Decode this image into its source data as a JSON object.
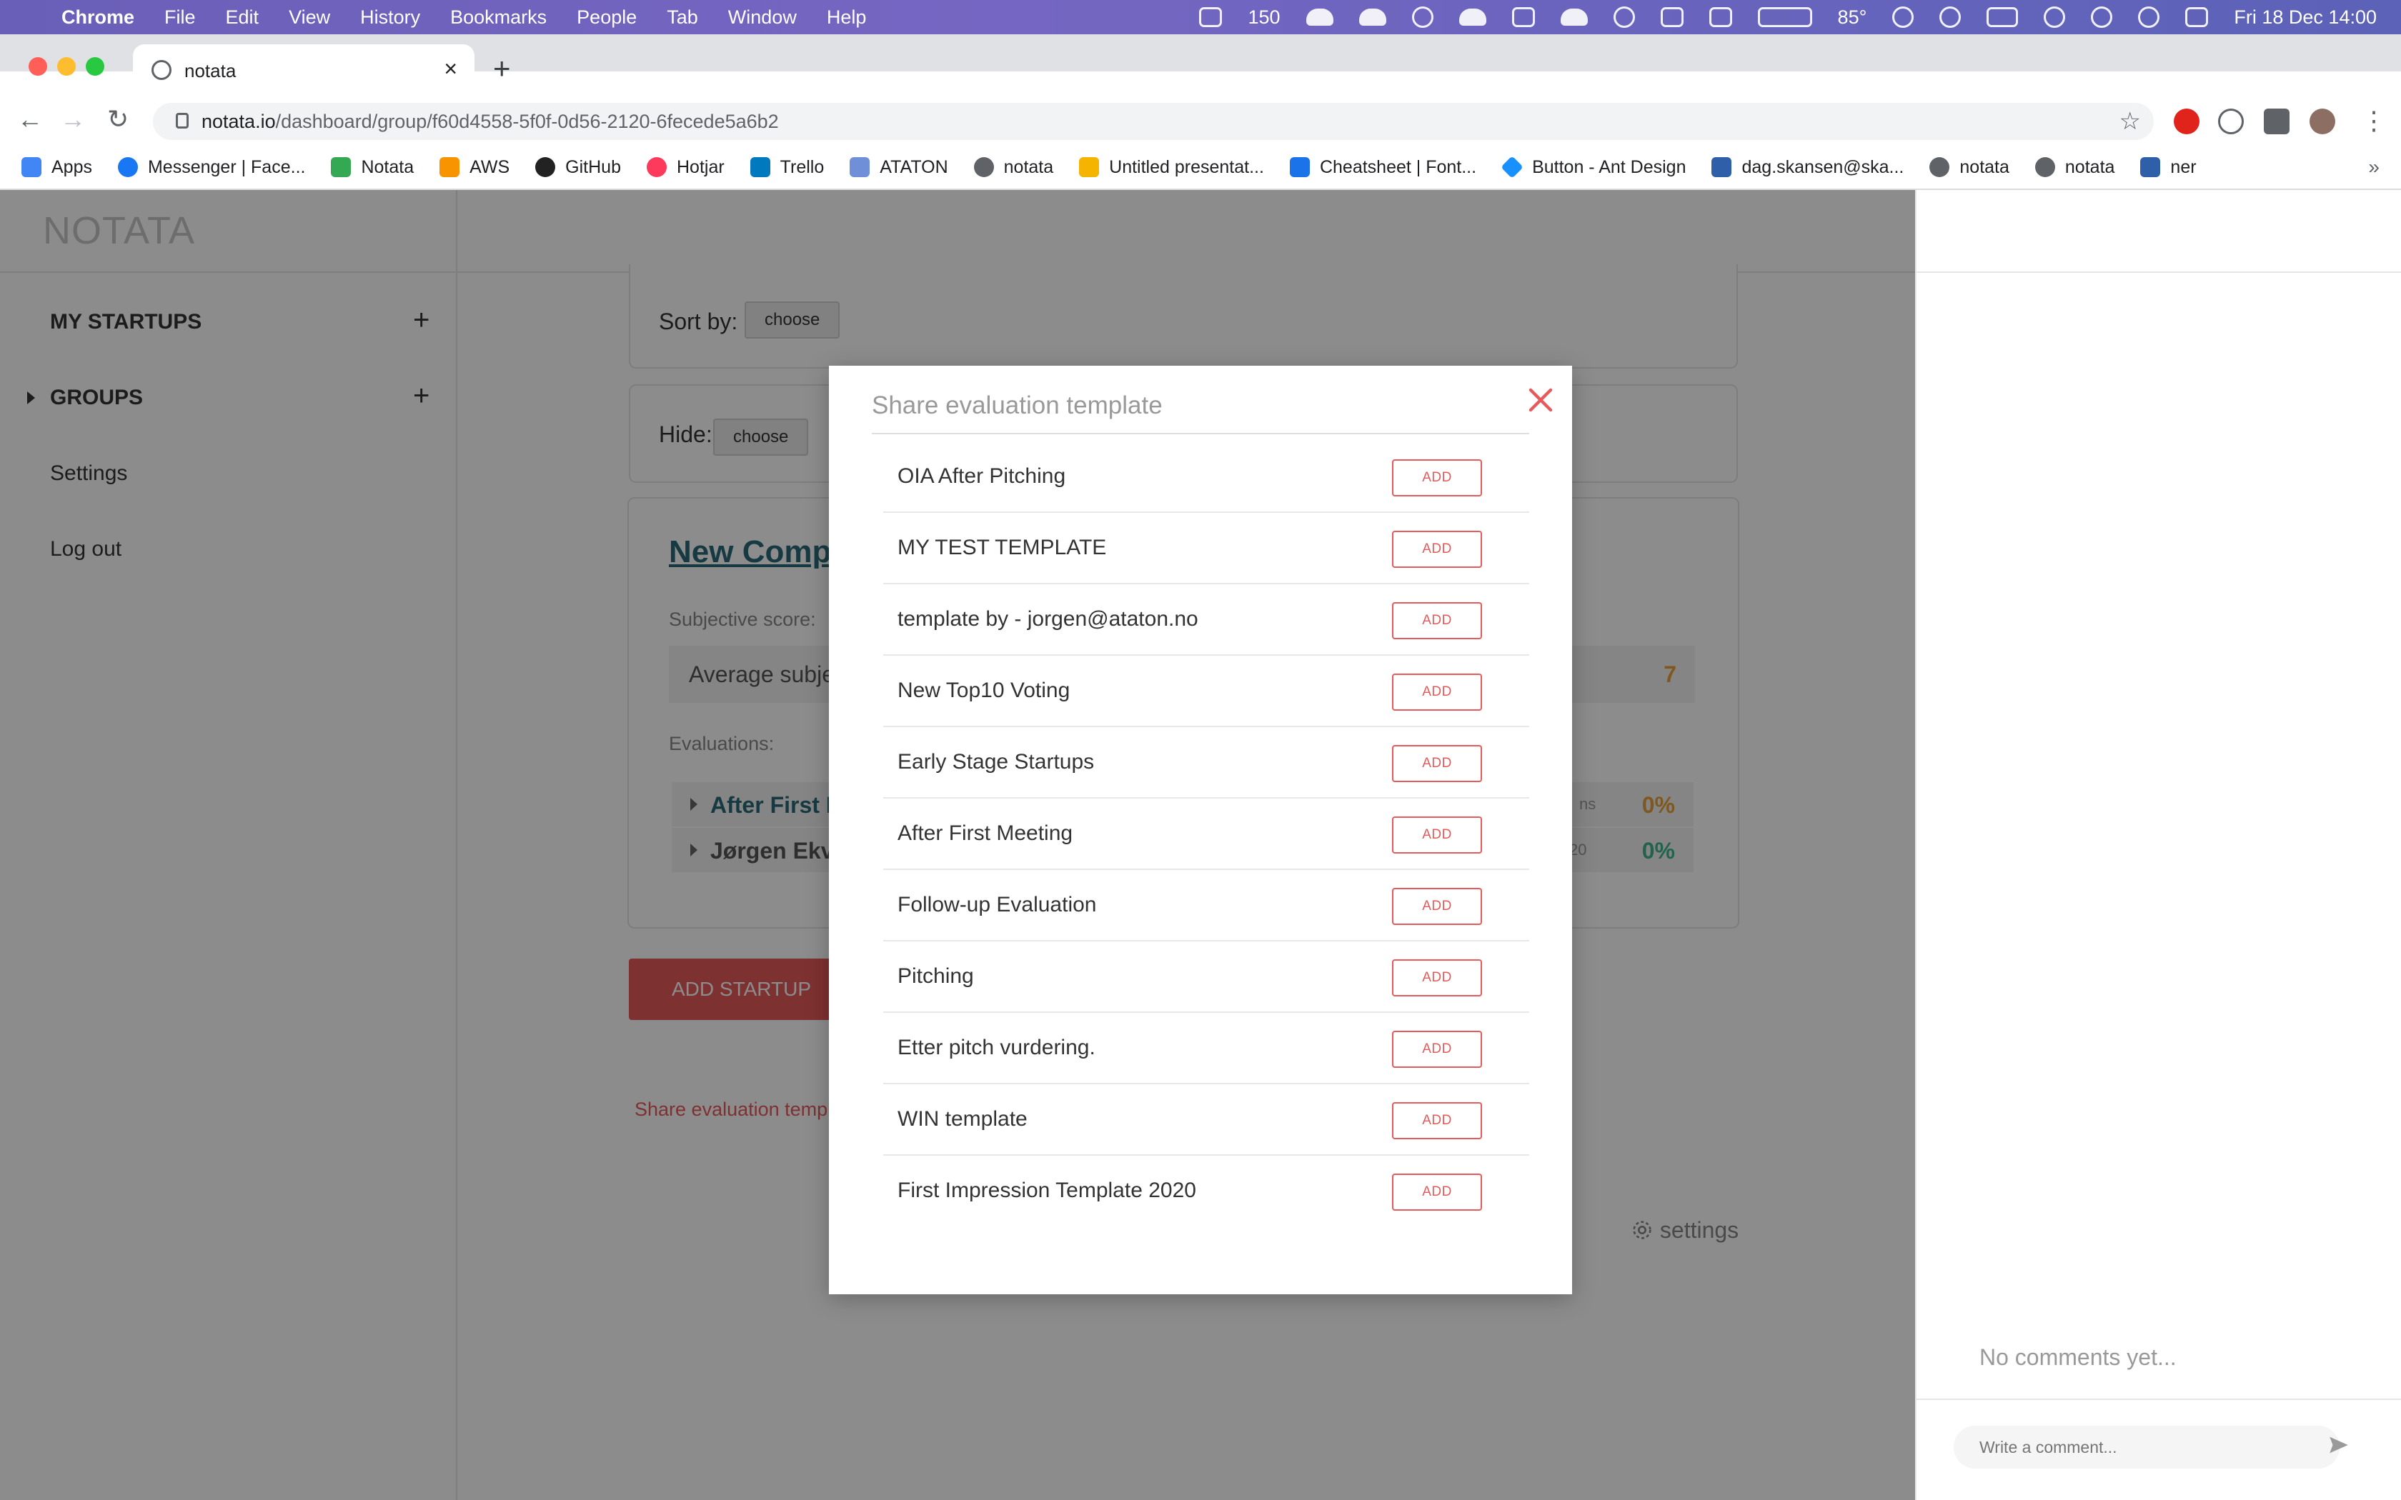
{
  "menubar": {
    "app": "Chrome",
    "items": [
      "File",
      "Edit",
      "View",
      "History",
      "Bookmarks",
      "People",
      "Tab",
      "Window",
      "Help"
    ],
    "status_count": "150",
    "temperature": "85°",
    "datetime": "Fri 18 Dec  14:00"
  },
  "browser": {
    "tab_title": "notata",
    "url_host": "notata.io",
    "url_path": "/dashboard/group/f60d4558-5f0f-0d56-2120-6fecede5a6b2",
    "bookmarks": [
      {
        "label": "Apps",
        "color": "#4285f4"
      },
      {
        "label": "Messenger | Face...",
        "color": "#1877f2"
      },
      {
        "label": "Notata",
        "color": "#34a853"
      },
      {
        "label": "AWS",
        "color": "#f79400"
      },
      {
        "label": "GitHub",
        "color": "#222222"
      },
      {
        "label": "Hotjar",
        "color": "#fd3a5c"
      },
      {
        "label": "Trello",
        "color": "#0079bf"
      },
      {
        "label": "ATATON",
        "color": "#6f8fd8"
      },
      {
        "label": "notata",
        "color": "#5f6368"
      },
      {
        "label": "Untitled presentat...",
        "color": "#f4b400"
      },
      {
        "label": "Cheatsheet | Font...",
        "color": "#1a73e8"
      },
      {
        "label": "Button - Ant Design",
        "color": "#1890ff"
      },
      {
        "label": "dag.skansen@ska...",
        "color": "#2f5fa8"
      },
      {
        "label": "notata",
        "color": "#5f6368"
      },
      {
        "label": "notata",
        "color": "#5f6368"
      },
      {
        "label": "ner",
        "color": "#2f5fa8"
      }
    ]
  },
  "sidebar": {
    "logo": "NOTATA",
    "my_startups": "MY STARTUPS",
    "groups": "GROUPS",
    "settings": "Settings",
    "logout": "Log out"
  },
  "main": {
    "sort_label": "Sort by:",
    "sort_value": "choose",
    "hide_label": "Hide:",
    "hide_value": "choose",
    "company_title": "New Comp",
    "subjective_label": "Subjective score:",
    "average_label": "Average subje",
    "average_value": "7",
    "evaluations_label": "Evaluations:",
    "evaluations": [
      {
        "name": "After First M",
        "suffix": "ns",
        "percent": "0%",
        "color": "#e8a13a"
      },
      {
        "name": "Jørgen Ekvo",
        "suffix": "20",
        "percent": "0%",
        "color": "#3fb58f"
      }
    ],
    "add_startup": "ADD STARTUP",
    "share_link": "Share evaluation templ",
    "settings_link": "settings"
  },
  "comments": {
    "empty_text": "No comments yet...",
    "input_placeholder": "Write a comment..."
  },
  "modal": {
    "title": "Share evaluation template",
    "add_label": "ADD",
    "templates": [
      "OIA After Pitching",
      "MY TEST TEMPLATE",
      "template by - jorgen@ataton.no",
      "New Top10 Voting",
      "Early Stage Startups",
      "After First Meeting",
      "Follow-up Evaluation",
      "Pitching",
      "Etter pitch vurdering.",
      "WIN template",
      "First Impression Template 2020"
    ]
  },
  "colors": {
    "accent_red": "#e55a5a",
    "link_teal": "#2b6b78",
    "score_orange": "#e8a13a",
    "score_green": "#3fb58f"
  }
}
